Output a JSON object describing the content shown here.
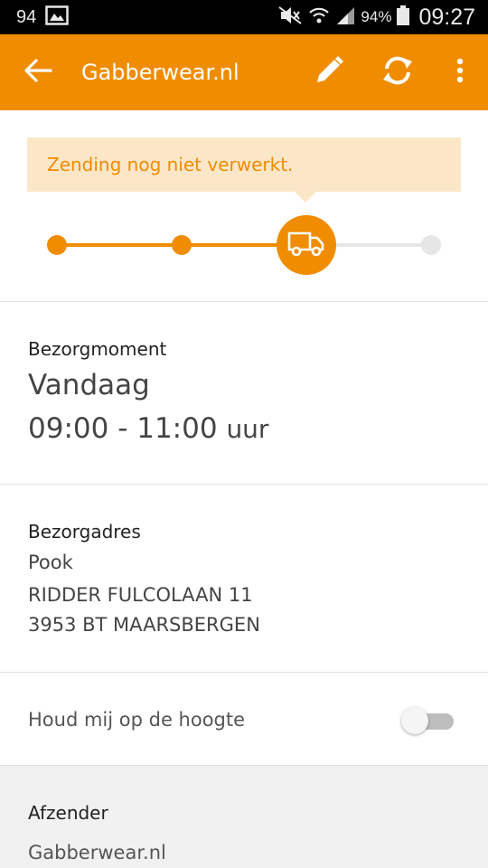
{
  "status_bar": {
    "notification_count": "94",
    "battery_percent": "94%",
    "time": "09:27",
    "icons": [
      "image-icon",
      "mute-icon",
      "wifi-icon",
      "signal-icon",
      "battery-icon"
    ]
  },
  "app_bar": {
    "title": "Gabberwear.nl",
    "icons": [
      "back-arrow-icon",
      "edit-pencil-icon",
      "refresh-icon",
      "more-vert-icon"
    ]
  },
  "status": {
    "message": "Zending nog niet verwerkt.",
    "progress": {
      "steps_total": 4,
      "current_step": 3,
      "current_icon": "delivery-truck-icon"
    }
  },
  "delivery_moment": {
    "label": "Bezorgmoment",
    "day": "Vandaag",
    "time_range": "09:00 - 11:00",
    "time_unit": "uur"
  },
  "delivery_address": {
    "label": "Bezorgadres",
    "name": "Pook",
    "street": "RIDDER FULCOLAAN 11",
    "postal_city": "3953 BT MAARSBERGEN"
  },
  "notify": {
    "label": "Houd mij op de hoogte",
    "enabled": false
  },
  "sender": {
    "label": "Afzender",
    "name": "Gabberwear.nl"
  },
  "colors": {
    "accent": "#f08c00",
    "banner_bg": "#fbe7c8",
    "inactive": "#e6e6e6",
    "sender_bg": "#f1f1f1"
  }
}
